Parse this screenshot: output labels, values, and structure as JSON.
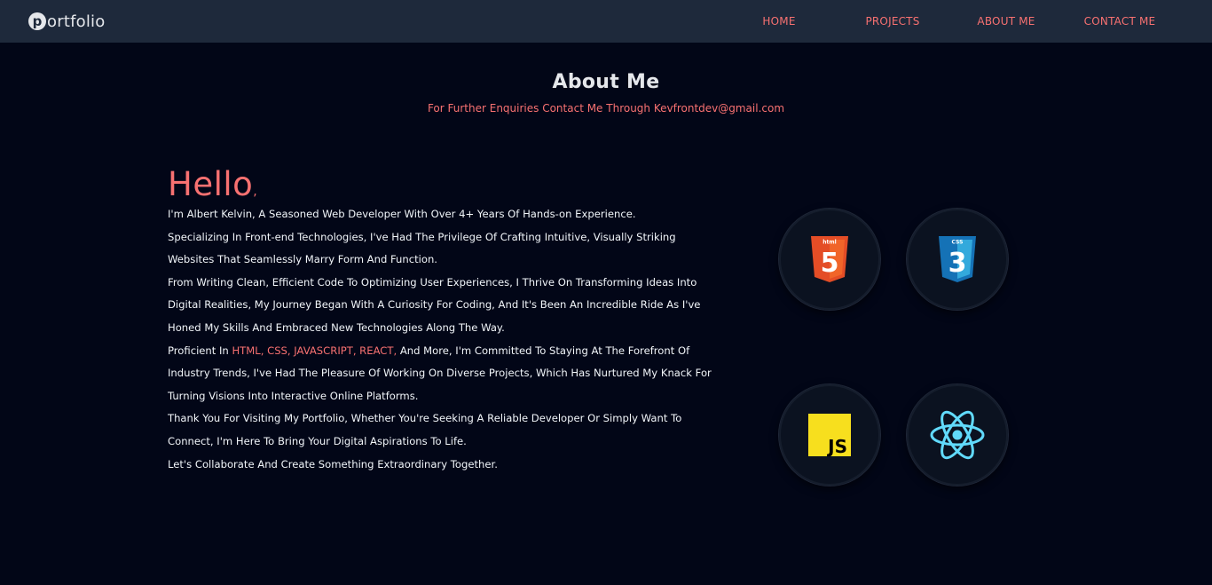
{
  "brand": {
    "logo_letter": "p",
    "logo_rest": "ortfolio"
  },
  "nav": {
    "home": "HOME",
    "projects": "PROJECTS",
    "about": "ABOUT ME",
    "contact": "CONTACT ME"
  },
  "about": {
    "title": "About Me",
    "subtitle": "For Further Enquiries Contact Me Through Kevfrontdev@gmail.com",
    "greeting": "Hello",
    "greeting_punct": ",",
    "intro": "I'm Albert Kelvin, A Seasoned Web Developer With Over 4+ Years Of Hands-on Experience.",
    "specialty": "Specializing In Front-end Technologies, I've Had The Privilege Of Crafting Intuitive, Visually Striking Websites That Seamlessly Marry Form And Function.",
    "journey": "From Writing Clean, Efficient Code To Optimizing User Experiences, I Thrive On Transforming Ideas Into Digital Realities, My Journey Began With A Curiosity For Coding, And It's Been An Incredible Ride As I've Honed My Skills And Embraced New Technologies Along The Way.",
    "proficient_prefix": "Proficient In ",
    "proficient_skills": "HTML, CSS, JAVASCRIPT, REACT,",
    "proficient_suffix": " And More, I'm Committed To Staying At The Forefront Of Industry Trends, I've Had The Pleasure Of Working On Diverse Projects, Which Has Nurtured My Knack For Turning Visions Into Interactive Online Platforms.",
    "thanks": "Thank You For Visiting My Portfolio, Whether You're Seeking A Reliable Developer Or Simply Want To Connect, I'm Here To Bring Your Digital Aspirations To Life.",
    "closing": "Let's Collaborate And Create Something Extraordinary Together."
  },
  "skills": [
    {
      "icon": "html5-icon",
      "badge": "html",
      "glyph": "5",
      "color": "#e44d26"
    },
    {
      "icon": "css3-icon",
      "badge": "CSS",
      "glyph": "3",
      "color": "#1572b6"
    },
    {
      "icon": "javascript-icon",
      "glyph": "JS",
      "color": "#f7df1e"
    },
    {
      "icon": "react-icon",
      "color": "#61dafb"
    }
  ],
  "colors": {
    "accent": "#f87171",
    "background": "#020617",
    "navbar": "#1e293b"
  }
}
